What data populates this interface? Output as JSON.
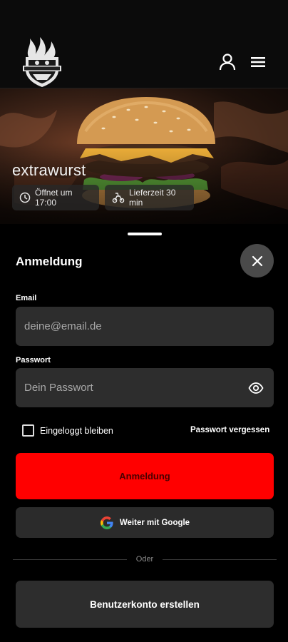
{
  "header": {
    "logo_text": "extrawurst",
    "icons": [
      "user-icon",
      "menu-icon"
    ]
  },
  "hero": {
    "title": "extrawurst",
    "opening_time": "Öffnet um 17:00",
    "delivery_time": "Lieferzeit 30 min",
    "icons": [
      "clock-icon",
      "delivery-icon"
    ]
  },
  "login": {
    "title": "Anmeldung",
    "email_label": "Email",
    "email_placeholder": "deine@email.de",
    "email_value": "",
    "password_label": "Passwort",
    "password_placeholder": "Dein Passwort",
    "password_value": "",
    "remember_me": "Eingeloggt bleiben",
    "remember_checked": false,
    "forgot_password": "Passwort vergessen",
    "submit_label": "Anmeldung",
    "google_label": "Weiter mit Google",
    "divider_text": "Oder",
    "create_account_label": "Benutzerkonto erstellen"
  },
  "colors": {
    "accent": "#ff0000",
    "field_bg": "#2d2d2d",
    "background": "#000000"
  }
}
